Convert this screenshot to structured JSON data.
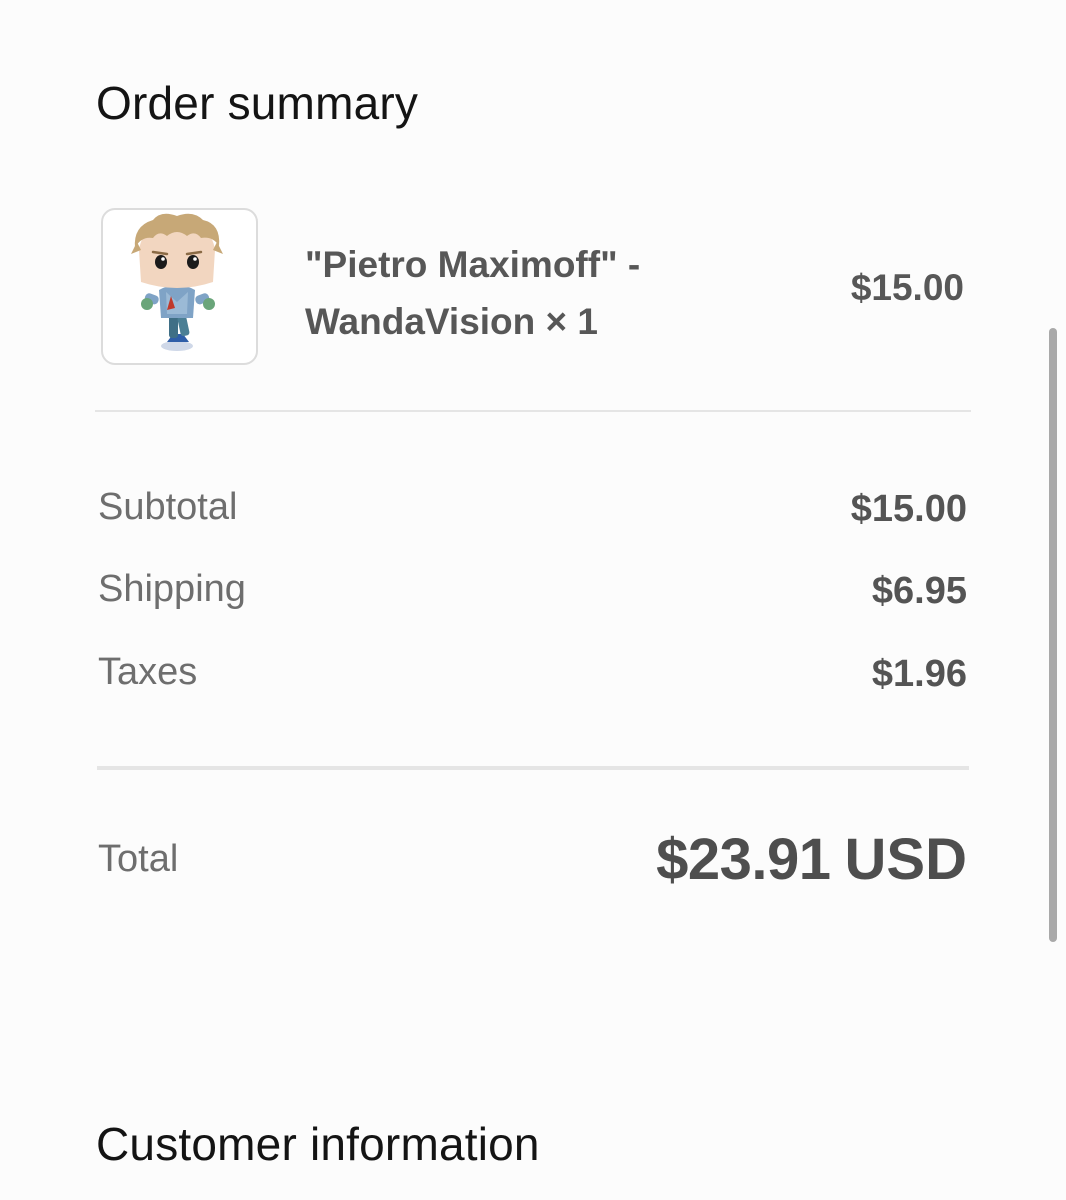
{
  "order_summary": {
    "title": "Order summary",
    "item": {
      "name": "\"Pietro Maximoff\" - WandaVision × 1",
      "price": "$15.00",
      "image_icon": "funko-pop-figure-thumbnail"
    },
    "subtotal": {
      "label": "Subtotal",
      "value": "$15.00"
    },
    "shipping": {
      "label": "Shipping",
      "value": "$6.95"
    },
    "taxes": {
      "label": "Taxes",
      "value": "$1.96"
    },
    "total": {
      "label": "Total",
      "amount": "$23.91",
      "currency": "USD"
    }
  },
  "customer_information": {
    "title": "Customer information"
  },
  "colors": {
    "background": "#fcfcfc",
    "title_text": "#141414",
    "label_text": "#6e6e6e",
    "value_text": "#545454",
    "divider": "#e5e5e5",
    "scrollbar": "#a9a9a9"
  }
}
